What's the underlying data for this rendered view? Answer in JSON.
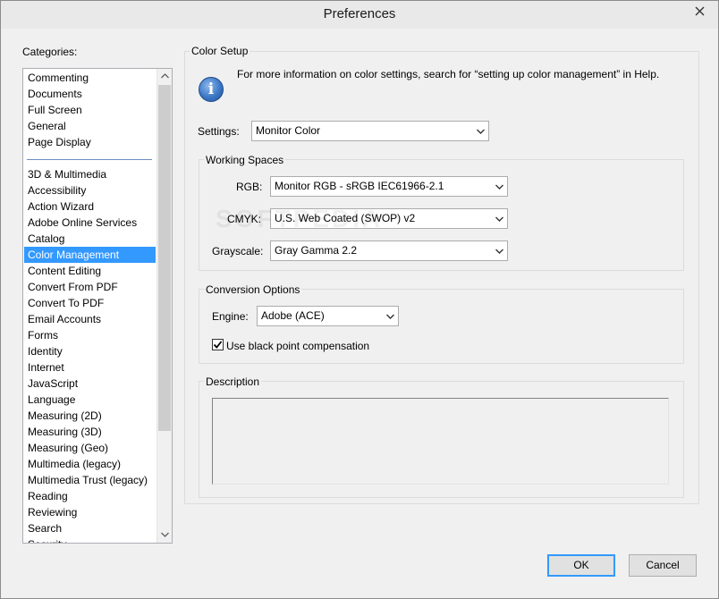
{
  "window": {
    "title": "Preferences",
    "close_glyph": "close-icon"
  },
  "categories": {
    "label": "Categories:",
    "items": [
      "Commenting",
      "Documents",
      "Full Screen",
      "General",
      "Page Display",
      "3D & Multimedia",
      "Accessibility",
      "Action Wizard",
      "Adobe Online Services",
      "Catalog",
      "Color Management",
      "Content Editing",
      "Convert From PDF",
      "Convert To PDF",
      "Email Accounts",
      "Forms",
      "Identity",
      "Internet",
      "JavaScript",
      "Language",
      "Measuring (2D)",
      "Measuring (3D)",
      "Measuring (Geo)",
      "Multimedia (legacy)",
      "Multimedia Trust (legacy)",
      "Reading",
      "Reviewing",
      "Search",
      "Security"
    ],
    "selected": "Color Management"
  },
  "color_setup": {
    "title": "Color Setup",
    "info_text": "For more information on color settings, search for “setting up color management” in Help.",
    "settings_label": "Settings:",
    "settings_value": "Monitor Color"
  },
  "working_spaces": {
    "title": "Working Spaces",
    "rgb_label": "RGB:",
    "rgb_value": "Monitor RGB - sRGB IEC61966-2.1",
    "cmyk_label": "CMYK:",
    "cmyk_value": "U.S. Web Coated (SWOP) v2",
    "gray_label": "Grayscale:",
    "gray_value": "Gray Gamma 2.2"
  },
  "conversion": {
    "title": "Conversion Options",
    "engine_label": "Engine:",
    "engine_value": "Adobe (ACE)",
    "black_point_label": "Use black point compensation",
    "black_point_checked": true
  },
  "description": {
    "title": "Description"
  },
  "buttons": {
    "ok": "OK",
    "cancel": "Cancel"
  },
  "watermark": "SOFTPEDIA",
  "colors": {
    "selection": "#3399ff",
    "info_icon": "#3c78c6"
  }
}
